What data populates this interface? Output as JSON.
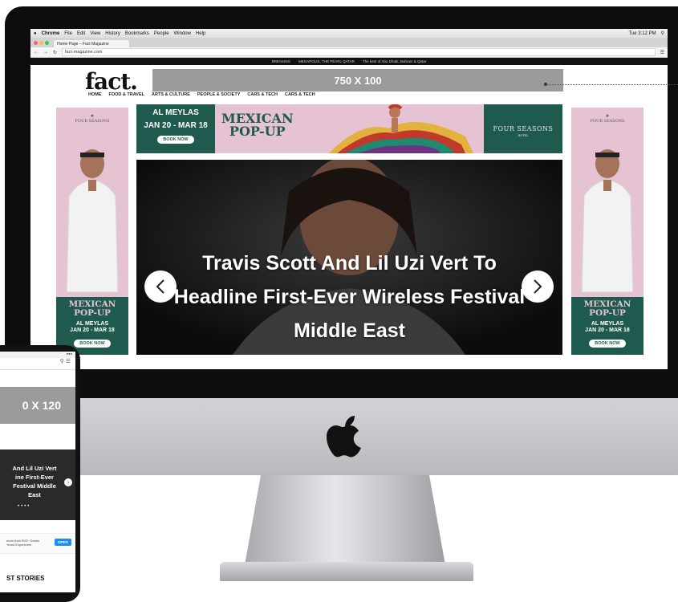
{
  "mac_menubar": {
    "apple": "",
    "app": "Chrome",
    "menus": [
      "File",
      "Edit",
      "View",
      "History",
      "Bookmarks",
      "People",
      "Window",
      "Help"
    ],
    "clock": "Tue 3:12 PM"
  },
  "browser": {
    "tab_title": "Home Page – Fact Magazine",
    "url": "fact-magazine.com"
  },
  "breaking_bar": {
    "label": "BREAKING",
    "headline": "MEGAPOLIS, THE PEARL QATAR",
    "right_text": "The best of Abu Dhabi, Bahrain & Qatar"
  },
  "site": {
    "logo": "fact.",
    "leaderboard": "750 X 100",
    "nav": [
      "HOME",
      "FOOD & TRAVEL",
      "ARTS & CULTURE",
      "PEOPLE & SOCIETY",
      "CARS & TECH",
      "CARS & TECH"
    ]
  },
  "ad_banner": {
    "title_line1": "AL MEYLAS",
    "title_line2": "JAN 20 - MAR 18",
    "button": "BOOK NOW",
    "mexican_line1": "MEXICAN",
    "mexican_line2": "POP-UP",
    "brand": "FOUR SEASONS",
    "brand_sub": "HOTEL"
  },
  "skyscraper": {
    "brand": "FOUR SEASONS",
    "mexican_line1": "MEXICAN",
    "mexican_line2": "POP-UP",
    "dates_line1": "AL MEYLAS",
    "dates_line2": "JAN 20 - MAR 18",
    "button": "BOOK NOW"
  },
  "hero": {
    "title": "Travis Scott And Lil Uzi Vert To Headline First-Ever Wireless Festival Middle East",
    "prev_icon": "chevron-left-icon",
    "next_icon": "chevron-right-icon"
  },
  "phone": {
    "ad": "0 X 120",
    "hero_title": "And Lil Uzi Vert ine First-Ever Festival Middle East",
    "app_text": "more than 500+ Gastro Years Experience",
    "open_button": "OPEN",
    "stories": "ST STORIES"
  },
  "colors": {
    "ad_green": "#1f5a4e",
    "ad_pink": "#e6c3d3",
    "placeholder_gray": "#9b9b9b",
    "imac_bezel": "#0d0d0f"
  }
}
